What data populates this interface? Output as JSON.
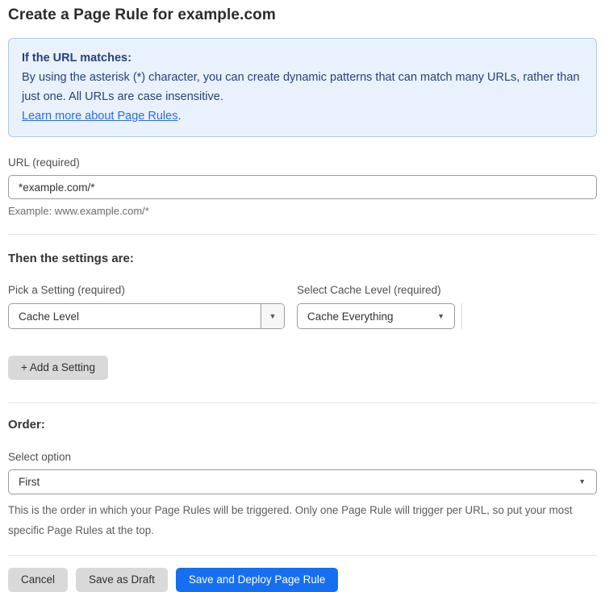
{
  "page": {
    "title": "Create a Page Rule for example.com"
  },
  "info_box": {
    "heading": "If the URL matches:",
    "body": "By using the asterisk (*) character, you can create dynamic patterns that can match many URLs, rather than just one. All URLs are case insensitive.",
    "link_label": "Learn more about Page Rules",
    "link_suffix": "."
  },
  "url_field": {
    "label": "URL (required)",
    "value": "*example.com/*",
    "helper": "Example: www.example.com/*"
  },
  "settings_section": {
    "heading": "Then the settings are:",
    "setting_picker": {
      "label": "Pick a Setting (required)",
      "value": "Cache Level"
    },
    "cache_level_picker": {
      "label": "Select Cache Level (required)",
      "value": "Cache Everything"
    },
    "add_setting_label": "+ Add a Setting"
  },
  "order_section": {
    "heading": "Order:",
    "label": "Select option",
    "value": "First",
    "helper": "This is the order in which your Page Rules will be triggered. Only one Page Rule will trigger per URL, so put your most specific Page Rules at the top."
  },
  "actions": {
    "cancel": "Cancel",
    "save_draft": "Save as Draft",
    "save_deploy": "Save and Deploy Page Rule"
  },
  "icons": {
    "dropdown_arrow": "▼"
  },
  "colors": {
    "info_bg": "#e9f2fc",
    "info_border": "#a9c9ee",
    "info_text": "#26427c",
    "link": "#2b6cd9",
    "primary_button": "#156ff0",
    "secondary_button": "#d9d9d9"
  }
}
